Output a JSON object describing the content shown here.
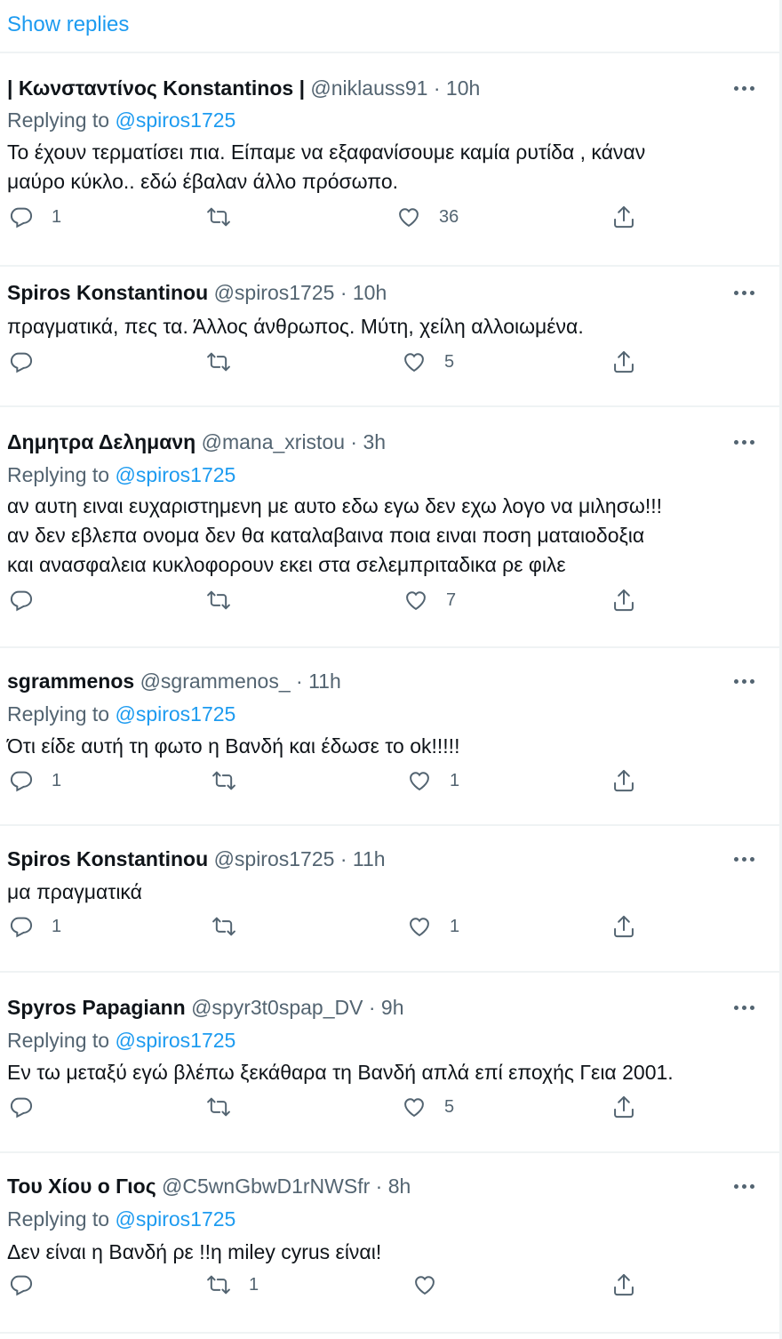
{
  "show_replies": "Show replies",
  "replying_prefix": "Replying to",
  "tweets": [
    {
      "name": "| Κωνσταντίνος Konstantinos |",
      "handle": "@niklauss91",
      "time": "10h",
      "replying_to": "@spiros1725",
      "lines": [
        "Το έχουν τερματίσει πια. Είπαμε να εξαφανίσουμε καμία ρυτίδα , κάναν",
        "μαύρο κύκλο.. εδώ έβαλαν άλλο πρόσωπο."
      ],
      "reply_count": "1",
      "retweet_count": "",
      "like_count": "36"
    },
    {
      "name": "Spiros Konstantinou",
      "handle": "@spiros1725",
      "time": "10h",
      "replying_to": "",
      "lines": [
        "πραγματικά, πες τα. Άλλος άνθρωπος.  Μύτη, χείλη αλλοιωμένα."
      ],
      "reply_count": "",
      "retweet_count": "",
      "like_count": "5"
    },
    {
      "name": "Δημητρα Δελημανη",
      "handle": "@mana_xristou",
      "time": "3h",
      "replying_to": "@spiros1725",
      "lines": [
        "αν αυτη ειναι ευχαριστημενη με αυτο εδω εγω δεν εχω λογο να μιλησω!!!",
        "αν δεν εβλεπα ονομα δεν θα καταλαβαινα ποια ειναι ποση ματαιοδοξια",
        "και ανασφαλεια κυκλοφορουν εκει στα σελεμπριταδικα ρε φιλε"
      ],
      "reply_count": "",
      "retweet_count": "",
      "like_count": "7"
    },
    {
      "name": "sgrammenos",
      "handle": "@sgrammenos_",
      "time": "11h",
      "replying_to": "@spiros1725",
      "lines": [
        "Ότι είδε αυτή τη φωτο η Βανδή και έδωσε το ok!!!!!"
      ],
      "reply_count": "1",
      "retweet_count": "",
      "like_count": "1"
    },
    {
      "name": "Spiros Konstantinou",
      "handle": "@spiros1725",
      "time": "11h",
      "replying_to": "",
      "lines": [
        "μα πραγματικά"
      ],
      "reply_count": "1",
      "retweet_count": "",
      "like_count": "1"
    },
    {
      "name": "Spyros Papagiann",
      "handle": "@spyr3t0spap_DV",
      "time": "9h",
      "replying_to": "@spiros1725",
      "lines": [
        "Εν τω μεταξύ εγώ βλέπω ξεκάθαρα τη Βανδή απλά επί εποχής Γεια 2001."
      ],
      "reply_count": "",
      "retweet_count": "",
      "like_count": "5"
    },
    {
      "name": "Του Χίου ο Γιος",
      "handle": "@C5wnGbwD1rNWSfr",
      "time": "8h",
      "replying_to": "@spiros1725",
      "lines": [
        "Δεν είναι η Βανδή ρε !!η miley cyrus είναι!"
      ],
      "reply_count": "",
      "retweet_count": "1",
      "like_count": ""
    }
  ],
  "icons": {
    "reply": "reply-icon",
    "retweet": "retweet-icon",
    "like": "like-icon",
    "share": "share-icon",
    "more": "more-icon"
  }
}
